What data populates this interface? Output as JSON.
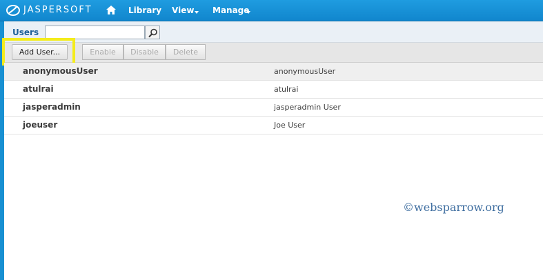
{
  "header": {
    "logo_text": "JASPERSOFT",
    "nav": [
      {
        "label": "Library",
        "has_menu": false
      },
      {
        "label": "View",
        "has_menu": true
      },
      {
        "label": "Manage",
        "has_menu": true
      }
    ],
    "icons": [
      "jaspersoft-logo-icon",
      "home-icon",
      "chevron-down-icon"
    ]
  },
  "search": {
    "section_title": "Users",
    "value": "",
    "placeholder": ""
  },
  "toolbar": {
    "add_user_label": "Add User...",
    "enable_label": "Enable",
    "disable_label": "Disable",
    "delete_label": "Delete"
  },
  "users": [
    {
      "username": "anonymousUser",
      "full_name": "anonymousUser"
    },
    {
      "username": "atulrai",
      "full_name": "atulrai"
    },
    {
      "username": "jasperadmin",
      "full_name": "jasperadmin User"
    },
    {
      "username": "joeuser",
      "full_name": "Joe User"
    }
  ],
  "watermark": "©websparrow.org",
  "colors": {
    "header": "#1186cd",
    "highlight": "#f4ec1c",
    "section_title": "#1d5f96"
  }
}
